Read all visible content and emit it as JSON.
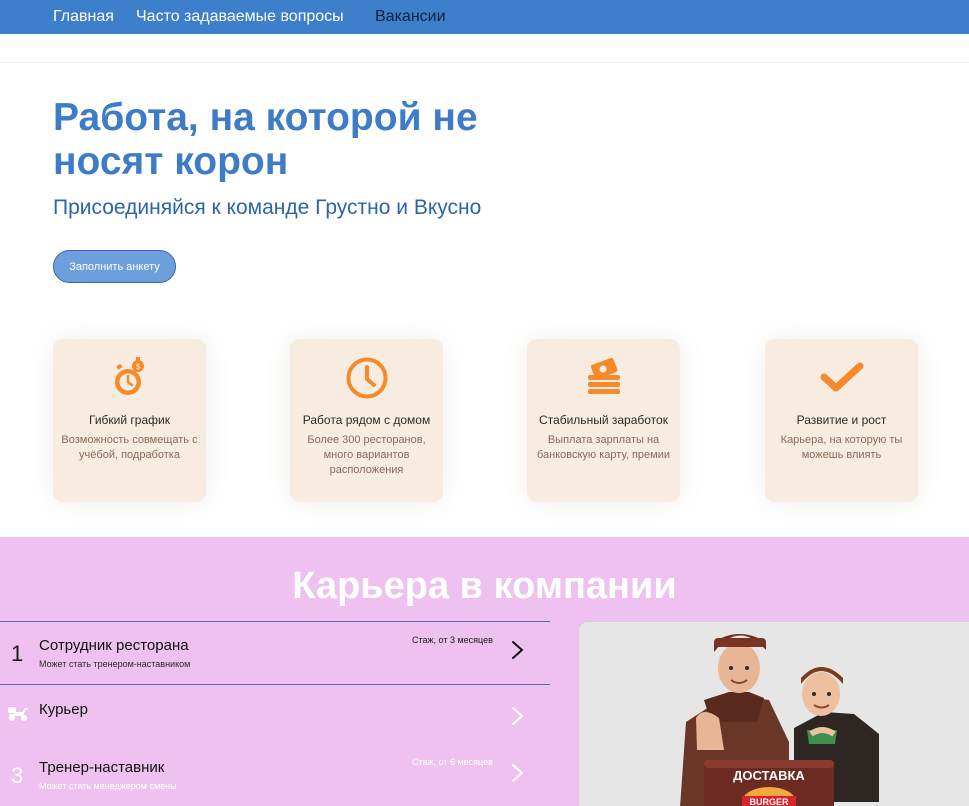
{
  "nav": {
    "items": [
      {
        "label": "Главная"
      },
      {
        "label": "Часто задаваемые вопросы"
      },
      {
        "label": "Вакансии"
      }
    ]
  },
  "hero": {
    "title": "Работа, на которой не носят корон",
    "subtitle": "Присоединяйся к команде Грустно и Вкусно",
    "cta_label": "Заполнить анкету"
  },
  "benefits": [
    {
      "icon": "stopwatch-icon",
      "title": "Гибкий график",
      "desc": "Возможность совмещать с учёбой, подработка"
    },
    {
      "icon": "clock-icon",
      "title": "Работа рядом с домом",
      "desc": "Более 300 ресторанов, много вариантов расположения"
    },
    {
      "icon": "money-icon",
      "title": "Стабильный заработок",
      "desc": "Выплата зарплаты на банковскую карту, премии"
    },
    {
      "icon": "checkmark-icon",
      "title": "Развитие и рост",
      "desc": "Карьера, на которую ты можешь влиять"
    }
  ],
  "career": {
    "title": "Карьера в компании",
    "jobs": [
      {
        "num": "1",
        "title": "Сотрудник ресторана",
        "subtitle": "Может стать тренером-наставником",
        "experience": "Стаж, от 3 месяцев"
      },
      {
        "num": "",
        "icon": "scooter-icon",
        "title": "Курьер",
        "subtitle": "",
        "experience": ""
      },
      {
        "num": "3",
        "title": "Тренер-наставник",
        "subtitle": "Может стать менеджером смены",
        "experience": "Стаж, от 6 месяцев"
      }
    ],
    "photo": {
      "bag_text": "ДОСТАВКА",
      "logo_text": "BURGER"
    }
  },
  "colors": {
    "nav_bg": "#3d7fcb",
    "accent_blue": "#3f7cc7",
    "card_bg": "#f7ecdf",
    "icon_orange": "#f58a2a",
    "career_bg": "#eec1f1"
  }
}
